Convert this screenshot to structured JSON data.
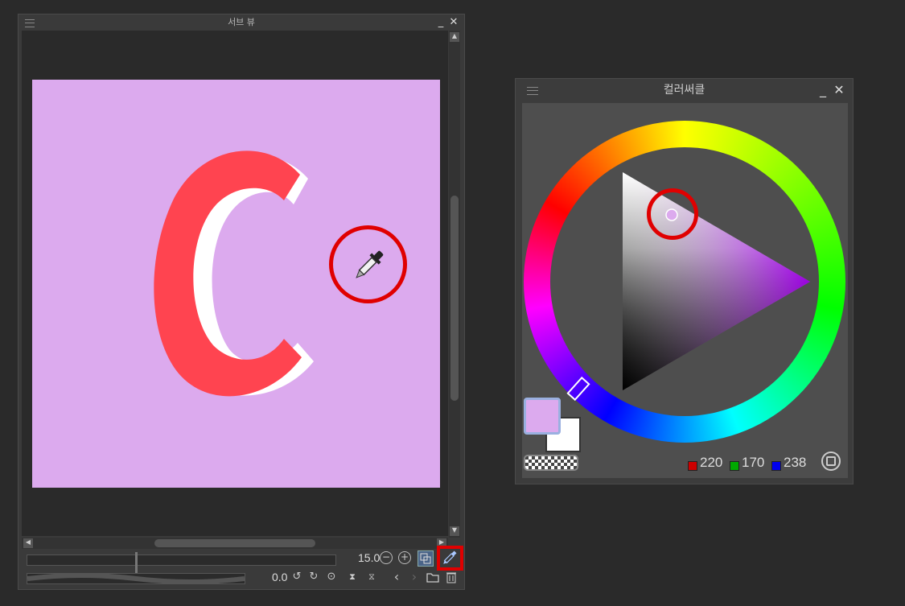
{
  "sub_view": {
    "title": "서브 뷰",
    "zoom_value": "15.0",
    "rotate_value": "0.0",
    "canvas_letter": "C",
    "canvas_color": "#dcaaee",
    "letter_color": "#ff4450"
  },
  "color_circle": {
    "title": "컬러써클",
    "main_color": "#dcaaee",
    "sub_color": "#ffffff",
    "rgb": {
      "r": "220",
      "g": "170",
      "b": "238"
    },
    "r_swatch": "#cc0000",
    "g_swatch": "#00aa00",
    "b_swatch": "#0000ee"
  }
}
